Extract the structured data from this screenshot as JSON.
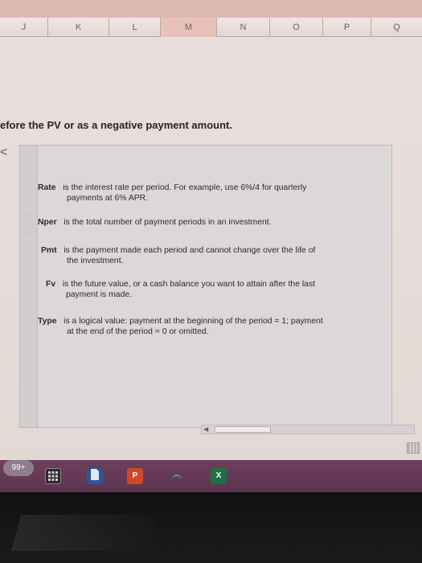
{
  "columns": [
    "J",
    "K",
    "L",
    "M",
    "N",
    "O",
    "P",
    "Q"
  ],
  "headline": "efore the PV or as a negative payment amount.",
  "chevron": "<",
  "params": [
    {
      "name": "Rate",
      "desc": "is the interest rate per period. For example, use 6%/4 for quarterly",
      "desc2": "payments at 6% APR."
    },
    {
      "name": "Nper",
      "desc": "is the total number of payment periods in an investment.",
      "desc2": ""
    },
    {
      "name": "Pmt",
      "desc": "is the payment made each period and cannot change over the life of",
      "desc2": "the investment."
    },
    {
      "name": "Fv",
      "desc": "is the future value, or a cash balance you want to attain after the last",
      "desc2": "payment is made."
    },
    {
      "name": "Type",
      "desc": "is a logical value: payment at the beginning of the period = 1; payment",
      "desc2": "at the end of the period = 0 or omitted."
    }
  ],
  "scroll_arrow": "◀",
  "taskbar": {
    "badge": "99+",
    "powerpoint_label": "P",
    "excel_label": "X"
  },
  "colors": {
    "taskbar": "#6f3f5c",
    "powerpoint": "#d24726",
    "excel": "#1e7145",
    "word": "#2b579a"
  }
}
